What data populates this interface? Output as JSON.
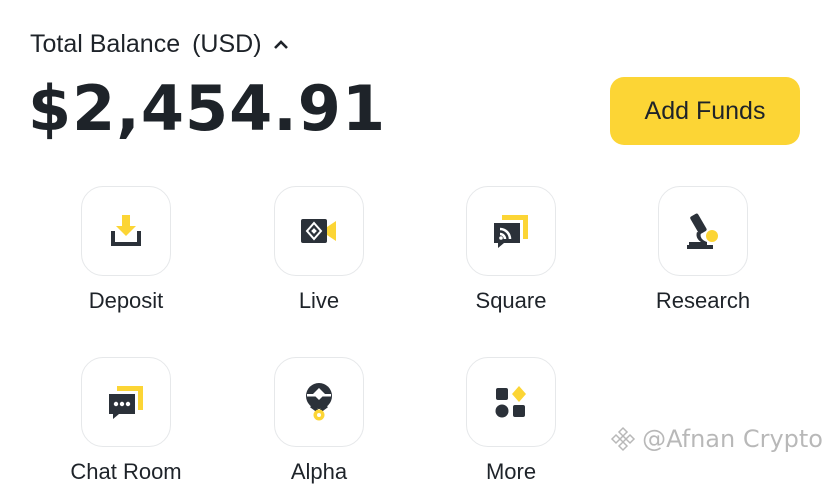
{
  "balance": {
    "label": "Total Balance",
    "currency": "(USD)",
    "amount": "$2,454.91"
  },
  "actions": {
    "add_funds": "Add Funds"
  },
  "shortcuts": [
    {
      "label": "Deposit",
      "icon": "deposit-icon"
    },
    {
      "label": "Live",
      "icon": "live-icon"
    },
    {
      "label": "Square",
      "icon": "square-icon"
    },
    {
      "label": "Research",
      "icon": "research-icon"
    },
    {
      "label": "Chat Room",
      "icon": "chat-icon"
    },
    {
      "label": "Alpha",
      "icon": "alpha-icon"
    },
    {
      "label": "More",
      "icon": "more-icon"
    }
  ],
  "watermark": {
    "text": "@Afnan Crypto"
  },
  "colors": {
    "accent": "#fcd535",
    "icon_dark": "#2b3139",
    "text": "#1e2329"
  }
}
